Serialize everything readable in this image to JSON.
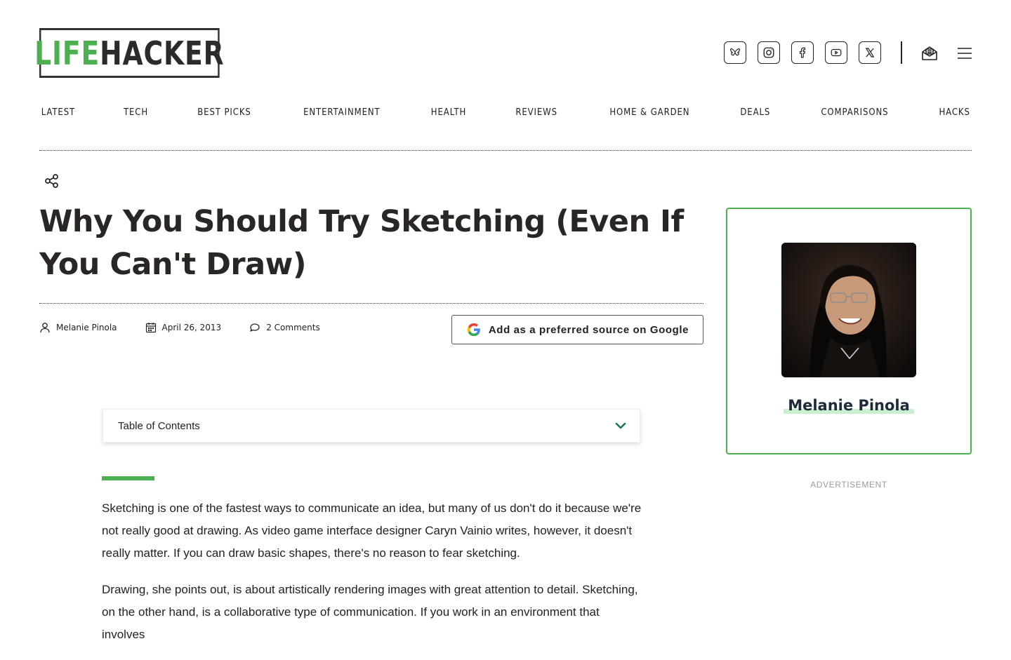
{
  "logo": {
    "part1": "LIFE",
    "part2": "HACKER"
  },
  "header": {
    "social_icons": [
      "bluesky-icon",
      "instagram-icon",
      "facebook-icon",
      "youtube-icon",
      "x-icon"
    ],
    "newsletter_icon": "newsletter-icon",
    "menu_icon": "hamburger-menu-icon"
  },
  "nav": {
    "items": [
      "LATEST",
      "TECH",
      "BEST PICKS",
      "ENTERTAINMENT",
      "HEALTH",
      "REVIEWS",
      "HOME & GARDEN",
      "DEALS",
      "COMPARISONS",
      "HACKS"
    ]
  },
  "article": {
    "title": "Why You Should Try Sketching (Even If You Can't Draw)",
    "author": "Melanie Pinola",
    "date": "April 26, 2013",
    "comments": "2 Comments",
    "google_button": "Add as a preferred source on Google",
    "toc_label": "Table of Contents",
    "paragraphs": [
      "Sketching is one of the fastest ways to communicate an idea, but many of us don't do it because we're not really good at drawing. As video game interface designer Caryn Vainio writes, however, it doesn't really matter. If you can draw basic shapes, there's no reason to fear sketching.",
      "Drawing, she points out, is about artistically rendering images with great attention to detail. Sketching, on the other hand, is a collaborative type of communication. If you work in an environment that involves"
    ]
  },
  "sidebar": {
    "author_name": "Melanie Pinola",
    "ad_label": "ADVERTISEMENT"
  },
  "colors": {
    "brand_green": "#4caf50",
    "text_dark": "#222222"
  }
}
